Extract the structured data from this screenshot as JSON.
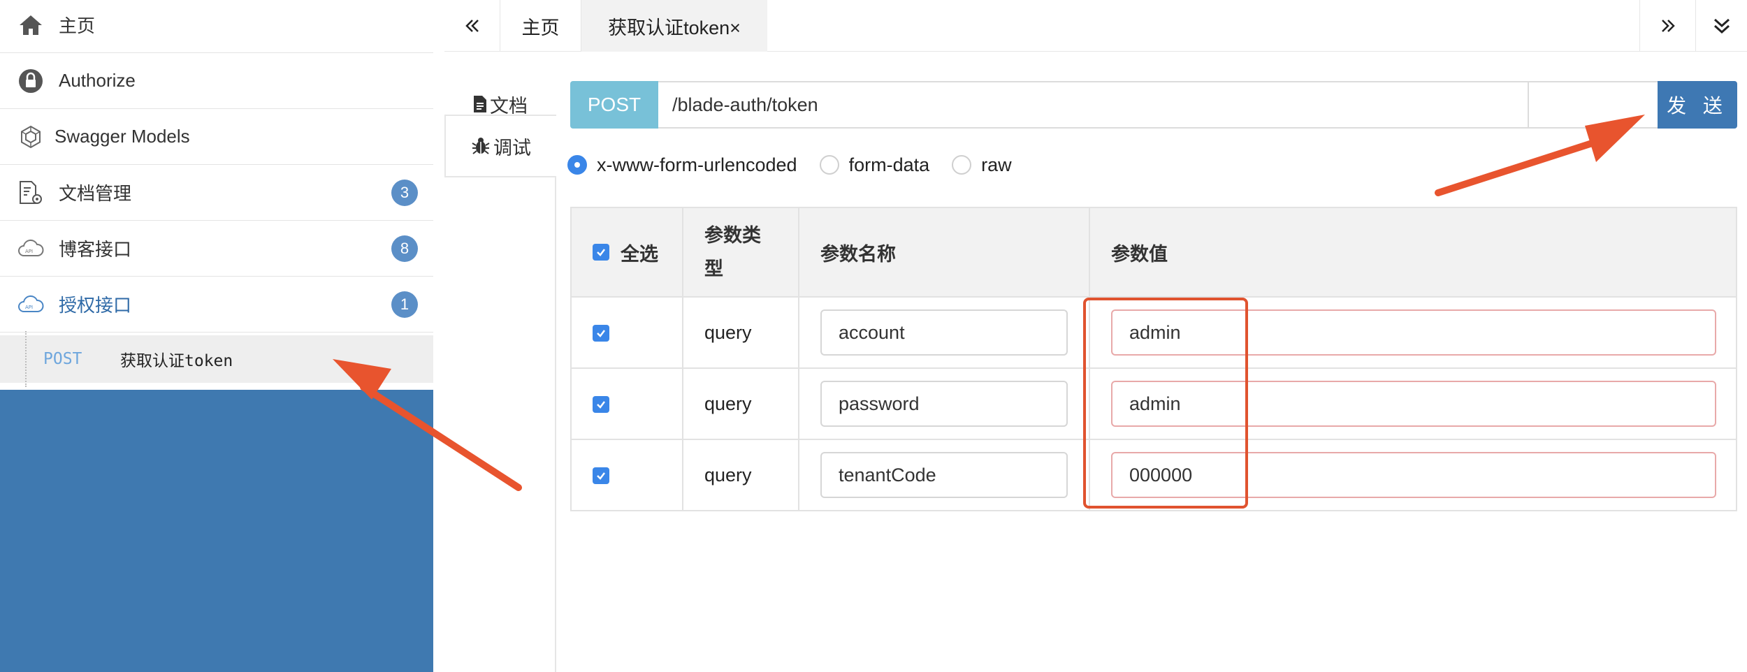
{
  "sidebar": {
    "items": [
      {
        "label": "主页",
        "icon": "home-icon"
      },
      {
        "label": "Authorize",
        "icon": "lock-icon"
      },
      {
        "label": "Swagger Models",
        "icon": "models-icon"
      },
      {
        "label": "文档管理",
        "icon": "doc-settings-icon",
        "badge": "3"
      },
      {
        "label": "博客接口",
        "icon": "api-cloud-icon",
        "badge": "8"
      },
      {
        "label": "授权接口",
        "icon": "api-cloud-icon",
        "badge": "1",
        "active": true
      }
    ],
    "sub_item": {
      "method": "POST",
      "name": "获取认证token"
    },
    "accent_color": "#3f79b0"
  },
  "topbar": {
    "prev_icon": "double-chevron-left-icon",
    "tabs": [
      {
        "label": "主页"
      },
      {
        "label": "获取认证token×",
        "active": true
      }
    ],
    "next_icon": "double-chevron-right-icon",
    "menu_icon": "double-chevron-down-icon"
  },
  "vtabs": {
    "doc_label": "文档",
    "debug_label": "调试"
  },
  "request": {
    "method": "POST",
    "url": "/blade-auth/token",
    "send_label": "发 送",
    "method_color": "#78c1d8",
    "send_color": "#3e78b3"
  },
  "body_types": [
    {
      "label": "x-www-form-urlencoded",
      "selected": true
    },
    {
      "label": "form-data",
      "selected": false
    },
    {
      "label": "raw",
      "selected": false
    }
  ],
  "params_table": {
    "headers": {
      "select_all": "全选",
      "type": "参数类型",
      "name": "参数名称",
      "value": "参数值"
    },
    "rows": [
      {
        "checked": true,
        "type": "query",
        "name": "account",
        "value": "admin"
      },
      {
        "checked": true,
        "type": "query",
        "name": "password",
        "value": "admin"
      },
      {
        "checked": true,
        "type": "query",
        "name": "tenantCode",
        "value": "000000"
      }
    ]
  },
  "annotations": {
    "arrow_color": "#e8542e"
  }
}
